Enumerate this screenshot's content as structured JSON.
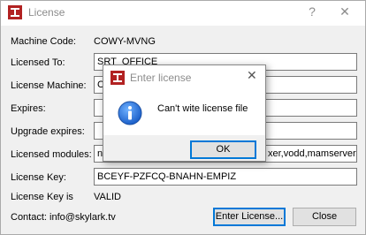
{
  "window": {
    "title": "License",
    "help_glyph": "?",
    "close_glyph": "✕"
  },
  "fields": {
    "machine_code_label": "Machine Code:",
    "machine_code_value": "COWY-MVNG",
    "licensed_to_label": "Licensed To:",
    "licensed_to_value": "SRT_OFFICE",
    "license_machine_label": "License Machine:",
    "license_machine_value": "C",
    "expires_label": "Expires:",
    "expires_value": "",
    "upgrade_expires_label": "Upgrade expires:",
    "upgrade_expires_value": "",
    "licensed_modules_label": "Licensed modules:",
    "licensed_modules_value_left": "ne",
    "licensed_modules_value_right": "xer,vodd,mamserver",
    "license_key_label": "License Key:",
    "license_key_value": "BCEYF-PZFCQ-BNAHN-EMPIZ",
    "license_key_is_label": "License Key is",
    "license_key_is_value": "VALID"
  },
  "footer": {
    "contact": "Contact: info@skylark.tv",
    "enter_license_label": "Enter License...",
    "close_label": "Close"
  },
  "dialog": {
    "title": "Enter license",
    "close_glyph": "✕",
    "message": "Can't wite license file",
    "ok_label": "OK",
    "icon": "info-icon"
  },
  "colors": {
    "accent": "#0078d7",
    "app_icon": "#c0392b"
  }
}
